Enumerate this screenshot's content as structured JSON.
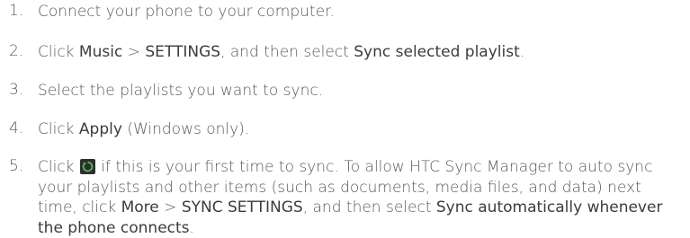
{
  "steps": [
    {
      "num": "1.",
      "text": "Connect your phone to your computer."
    },
    {
      "num": "2.",
      "t1": "Click ",
      "b1": "Music",
      "t2": " > ",
      "b2": "SETTINGS",
      "t3": ", and then select ",
      "b3": "Sync selected playlist",
      "t4": "."
    },
    {
      "num": "3.",
      "text": "Select the playlists you want to sync."
    },
    {
      "num": "4.",
      "t1": "Click ",
      "b1": "Apply",
      "t2": " (Windows only)."
    },
    {
      "num": "5.",
      "t1": "Click ",
      "icon": "sync-icon",
      "t2": " if this is your first time to sync. To allow HTC Sync Manager to auto sync your playlists and other items (such as documents, media files, and data) next time, click ",
      "b1": "More",
      "t3": " > ",
      "b2": "SYNC SETTINGS",
      "t4": ", and then select ",
      "b3": "Sync automatically whenever the phone connects",
      "t5": "."
    }
  ]
}
